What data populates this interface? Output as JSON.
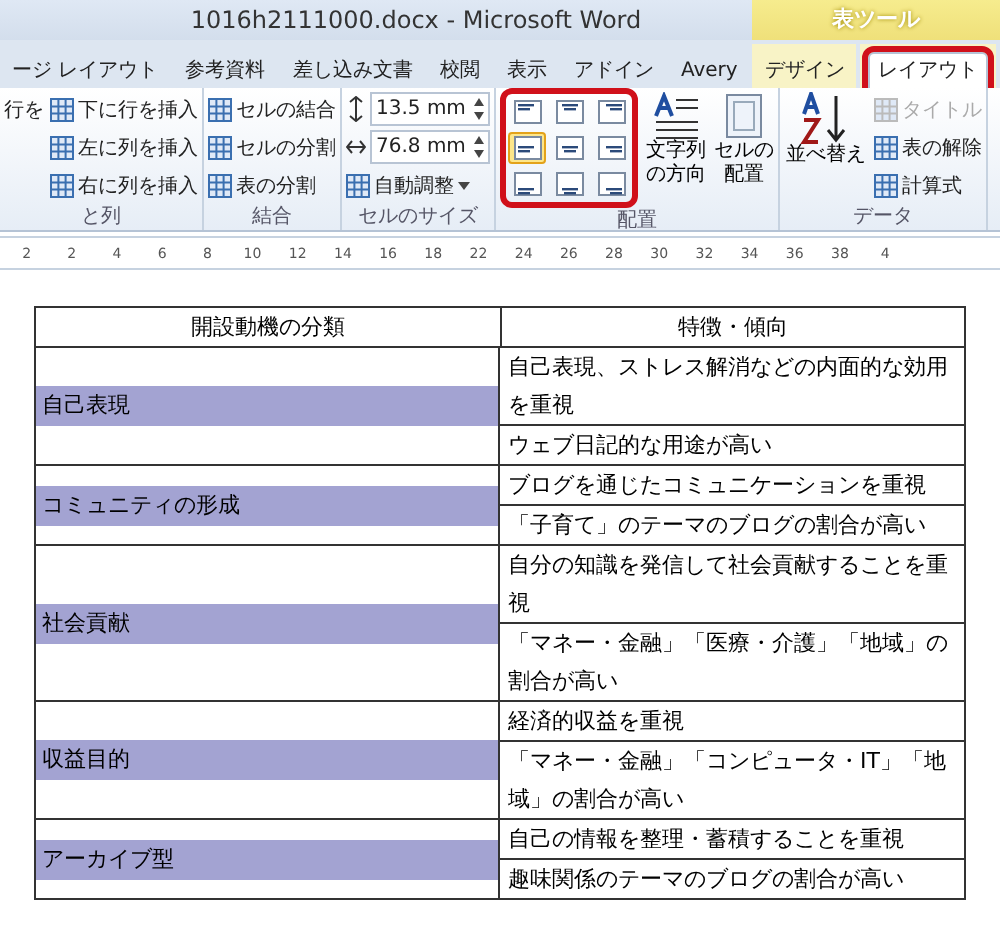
{
  "window": {
    "title": "1016h2111000.docx - Microsoft Word",
    "context_label": "表ツール"
  },
  "tabs": [
    {
      "label": "ージ レイアウト",
      "selected": false,
      "highlighted": false
    },
    {
      "label": "参考資料",
      "selected": false,
      "highlighted": false
    },
    {
      "label": "差し込み文書",
      "selected": false,
      "highlighted": false
    },
    {
      "label": "校閲",
      "selected": false,
      "highlighted": false
    },
    {
      "label": "表示",
      "selected": false,
      "highlighted": false
    },
    {
      "label": "アドイン",
      "selected": false,
      "highlighted": false
    },
    {
      "label": "Avery",
      "selected": false,
      "highlighted": false
    },
    {
      "label": "デザイン",
      "selected": false,
      "highlighted": false,
      "contextual": true
    },
    {
      "label": "レイアウト",
      "selected": true,
      "highlighted": true,
      "contextual": true
    }
  ],
  "ribbon": {
    "rows_columns": {
      "label": "と列",
      "partial_button": "行を",
      "items": [
        "下に行を挿入",
        "左に列を挿入",
        "右に列を挿入"
      ]
    },
    "merge": {
      "label": "結合",
      "items": [
        "セルの結合",
        "セルの分割",
        "表の分割"
      ]
    },
    "cell_size": {
      "label": "セルのサイズ",
      "height": "13.5 mm",
      "width": "76.8 mm",
      "autofit": "自動調整"
    },
    "alignment": {
      "label": "配置",
      "highlighted": true,
      "buttons": [
        {
          "selected": false
        },
        {
          "selected": false
        },
        {
          "selected": false
        },
        {
          "selected": true
        },
        {
          "selected": false
        },
        {
          "selected": false
        },
        {
          "selected": false
        },
        {
          "selected": false
        },
        {
          "selected": false
        }
      ],
      "text_direction": "文字列の方向",
      "cell_margins": "セルの配置"
    },
    "data": {
      "label": "データ",
      "sort": "並べ替え",
      "items": [
        {
          "label": "タイトル",
          "disabled": true
        },
        {
          "label": "表の解除",
          "disabled": false
        },
        {
          "label": "計算式",
          "disabled": false
        }
      ]
    }
  },
  "ruler": {
    "ticks": [
      "2",
      "2",
      "4",
      "6",
      "8",
      "10",
      "12",
      "14",
      "16",
      "18",
      "22",
      "24",
      "26",
      "28",
      "30",
      "32",
      "34",
      "36",
      "38",
      "4"
    ]
  },
  "table": {
    "columns": [
      "開設動機の分類",
      "特徴・傾向"
    ],
    "groups": [
      {
        "category": "自己表現",
        "items": [
          "自己表現、ストレス解消などの内面的な効用を重視",
          "ウェブ日記的な用途が高い"
        ]
      },
      {
        "category": "コミュニティの形成",
        "items": [
          "ブログを通じたコミュニケーションを重視",
          "「子育て」のテーマのブログの割合が高い"
        ]
      },
      {
        "category": "社会貢献",
        "items": [
          "自分の知識を発信して社会貢献することを重視",
          "「マネー・金融」「医療・介護」「地域」の割合が高い"
        ]
      },
      {
        "category": "収益目的",
        "items": [
          "経済的収益を重視",
          "「マネー・金融」「コンピュータ・IT」「地域」の割合が高い"
        ]
      },
      {
        "category": "アーカイブ型",
        "items": [
          "自己の情報を整理・蓄積することを重視",
          "趣味関係のテーマのブログの割合が高い"
        ]
      }
    ]
  }
}
